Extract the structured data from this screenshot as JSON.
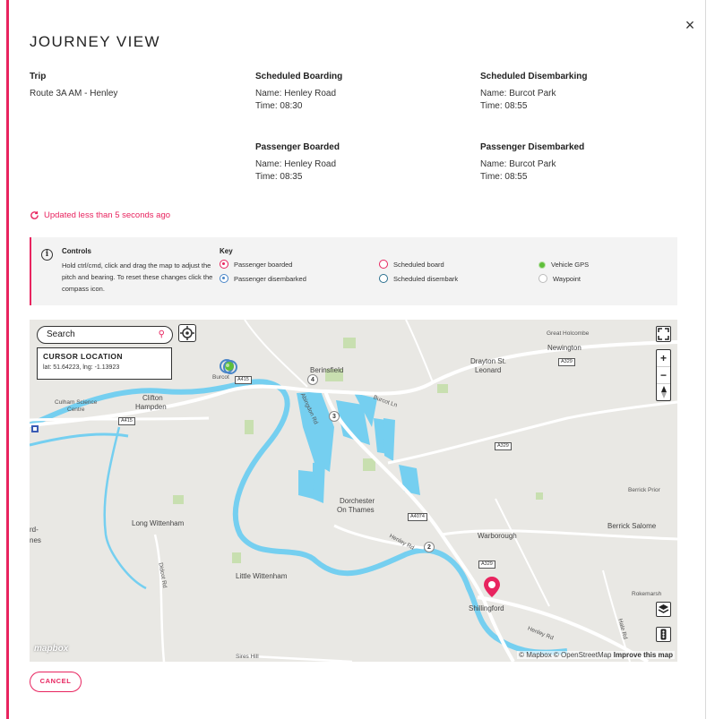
{
  "modal": {
    "title": "JOURNEY VIEW",
    "close_label": "×"
  },
  "trip": {
    "label": "Trip",
    "value": "Route 3A AM - Henley"
  },
  "scheduled_boarding": {
    "label": "Scheduled Boarding",
    "name": "Name: Henley Road",
    "time": "Time: 08:30"
  },
  "scheduled_disembarking": {
    "label": "Scheduled Disembarking",
    "name": "Name: Burcot Park",
    "time": "Time: 08:55"
  },
  "passenger_boarded": {
    "label": "Passenger Boarded",
    "name": "Name: Henley Road",
    "time": "Time: 08:35"
  },
  "passenger_disembarked": {
    "label": "Passenger Disembarked",
    "name": "Name: Burcot Park",
    "time": "Time: 08:55"
  },
  "updated_status": "Updated less than 5 seconds ago",
  "controls": {
    "title": "Controls",
    "text": "Hold ctrl/cmd, click and drag the map to adjust the pitch and bearing. To reset these changes click the compass icon.",
    "key_title": "Key",
    "keys": [
      {
        "label": "Passenger boarded"
      },
      {
        "label": "Passenger disembarked"
      },
      {
        "label": "Scheduled board"
      },
      {
        "label": "Scheduled disembark"
      },
      {
        "label": "Vehicle GPS"
      },
      {
        "label": "Waypoint"
      }
    ]
  },
  "map": {
    "search_value": "Search",
    "cursor_location": {
      "title": "CURSOR LOCATION",
      "value": "lat: 51.64223, lng: -1.13923"
    },
    "zoom_in": "+",
    "zoom_out": "−",
    "labels": {
      "great_holcombe": "Great Holcombe",
      "newington": "Newington",
      "drayton": "Drayton St.",
      "leonard": "Leonard",
      "berinsfield": "Berinsfield",
      "burcot": "Burcot",
      "clifton": "Clifton",
      "hampden": "Hampden",
      "culham": "Culham Science",
      "centre": "Centre",
      "burcot_ln": "Burcot Ln",
      "abingdon_rd": "Abingdon Rd",
      "dorchester": "Dorchester",
      "on_thames": "On Thames",
      "long_wittenham": "Long Wittenham",
      "henley_rd": "Henley Rd",
      "warborough": "Warborough",
      "berrick_prior": "Berrick Prior",
      "berrick_salome": "Berrick Salome",
      "didcot_rd": "Didcot Rd",
      "little_wittenham": "Little Wittenham",
      "shillingford": "Shillingford",
      "rokemarsh": "Rokemarsh",
      "henley_rd2": "Henley Rd",
      "hale_rd": "Hale Rd",
      "sires_hill": "Sires Hill",
      "ord": "rd-",
      "nes": "nes"
    },
    "shields": {
      "a415a": "A415",
      "a415b": "A415",
      "a329a": "A329",
      "a329b": "A329",
      "a329c": "A329",
      "a4074": "A4074"
    },
    "markers": [
      "4",
      "3",
      "2"
    ],
    "mapbox_logo": "mapbox",
    "attribution_1": "© Mapbox © OpenStreetMap",
    "attribution_2": "Improve this map"
  },
  "cancel_label": "CANCEL",
  "colors": {
    "accent": "#e8245f",
    "water": "#75cff0",
    "green": "#c8dfb0"
  }
}
